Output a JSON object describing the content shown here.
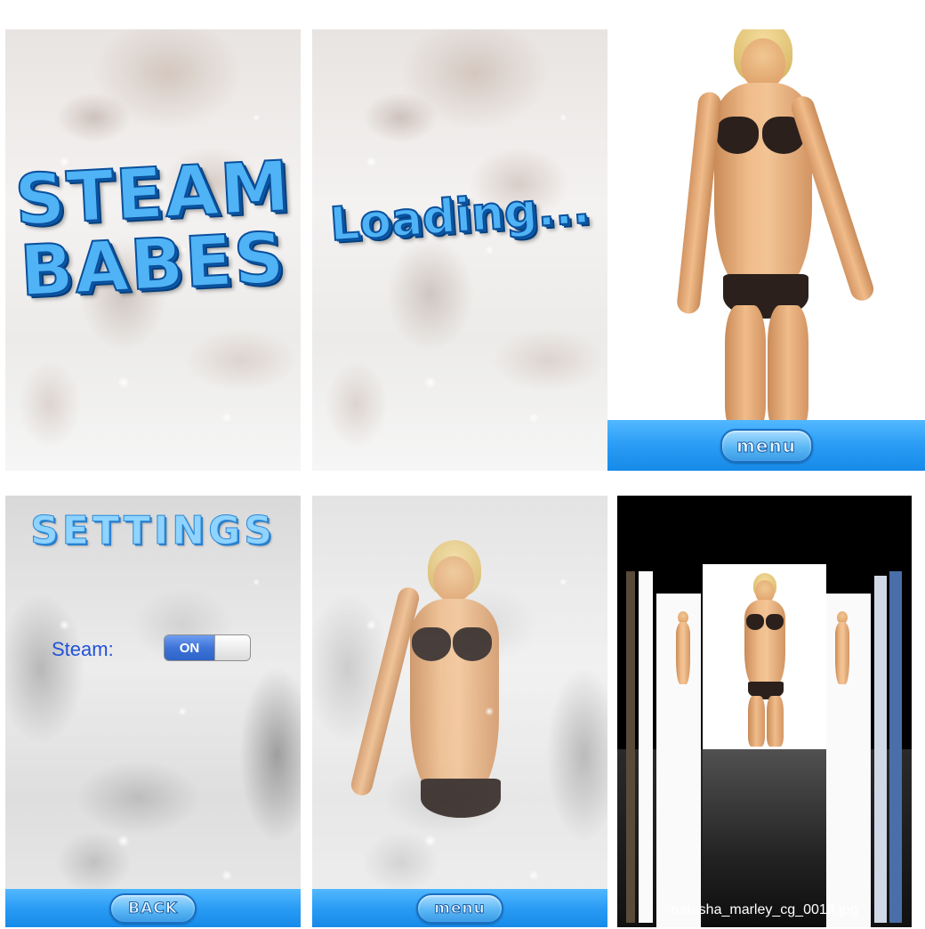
{
  "screens": {
    "splash": {
      "title_line1": "STEAM",
      "title_line2": "BABES"
    },
    "loading": {
      "text": "Loading..."
    },
    "photo_view": {
      "menu_button": "menu"
    },
    "settings": {
      "title": "SETTINGS",
      "steam_label": "Steam:",
      "steam_toggle": "ON",
      "back_button": "BACK"
    },
    "steam_view": {
      "menu_button": "menu"
    },
    "gallery": {
      "caption": "natasha_marley_cg_0018.jpg"
    }
  },
  "colors": {
    "bar_blue": "#2a9cf5",
    "title_blue": "#4fb3f6",
    "label_blue": "#2152d8",
    "toggle_blue": "#3e73d8"
  },
  "icons": {
    "coverflow": "image-stack"
  }
}
